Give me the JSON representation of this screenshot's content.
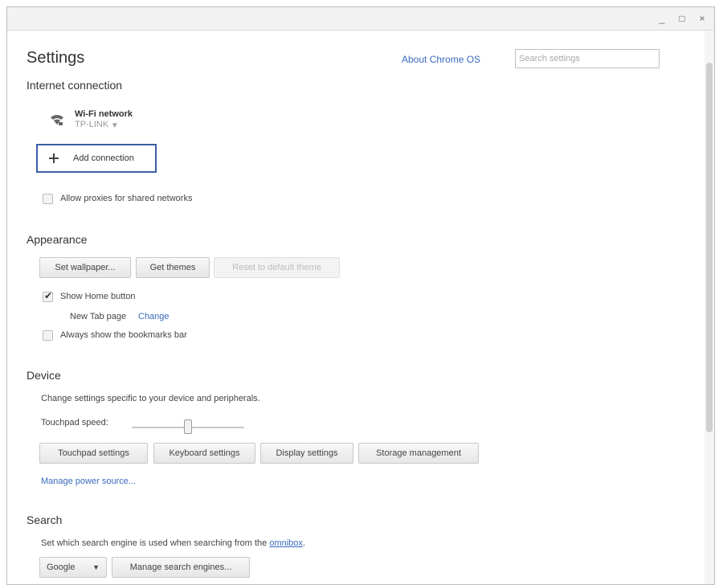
{
  "window": {
    "minimize": "_",
    "maximize": "□",
    "close": "×"
  },
  "header": {
    "title": "Settings",
    "about_link": "About Chrome OS",
    "search_placeholder": "Search settings"
  },
  "internet": {
    "section_title": "Internet connection",
    "network_label": "Wi-Fi network",
    "network_name": "TP-LINK",
    "network_dropdown": "▾",
    "add_connection_label": "Add connection",
    "allow_proxies_label": "Allow proxies for shared networks",
    "allow_proxies_checked": false
  },
  "appearance": {
    "section_title": "Appearance",
    "buttons": {
      "wallpaper": "Set wallpaper...",
      "themes": "Get themes",
      "reset_theme": "Reset to default theme"
    },
    "show_home_label": "Show Home button",
    "show_home_checked": true,
    "new_tab_text": "New Tab page",
    "change_link": "Change",
    "bookmarks_label": "Always show the bookmarks bar",
    "bookmarks_checked": false
  },
  "device": {
    "section_title": "Device",
    "description": "Change settings specific to your device and peripherals.",
    "touchpad_speed_label": "Touchpad speed:",
    "touchpad_speed_level": 0.5,
    "buttons": {
      "touchpad": "Touchpad settings",
      "keyboard": "Keyboard settings",
      "display": "Display settings",
      "storage": "Storage management"
    },
    "power_link": "Manage power source..."
  },
  "search": {
    "section_title": "Search",
    "description_prefix": "Set which search engine is used when searching from the ",
    "omnibox_link": "omnibox",
    "description_suffix": ".",
    "engine_select": "Google",
    "engine_select_arrow": "▼",
    "manage_button": "Manage search engines..."
  },
  "colors": {
    "link": "#3a6bbf",
    "focus_border": "#3b5ea6"
  }
}
